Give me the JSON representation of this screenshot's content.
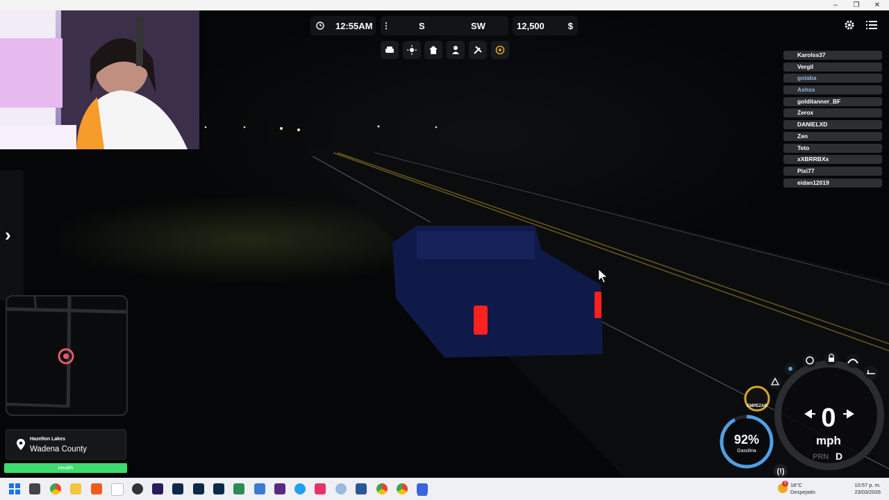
{
  "window": {
    "minimize": "–",
    "maximize": "❐",
    "close": "✕"
  },
  "hud": {
    "time": "12:55AM",
    "compass_heading": "S",
    "compass_next": "SW",
    "money": "12,500",
    "currency": "$"
  },
  "toolbar_icons": [
    "car-icon",
    "sun-icon",
    "home-icon",
    "person-icon",
    "tools-icon",
    "settings-circle-icon"
  ],
  "players": [
    {
      "name": "Karolss37",
      "highlight": false
    },
    {
      "name": "Vergil",
      "highlight": false
    },
    {
      "name": "goiaba",
      "highlight": true
    },
    {
      "name": "Ashxs",
      "highlight": true
    },
    {
      "name": "golditanner_BF",
      "highlight": false
    },
    {
      "name": "Zerox",
      "highlight": false
    },
    {
      "name": "DANIELXD",
      "highlight": false
    },
    {
      "name": "Zen",
      "highlight": false
    },
    {
      "name": "Teto",
      "highlight": false
    },
    {
      "name": "xXBRRBXx",
      "highlight": false
    },
    {
      "name": "Pixi77",
      "highlight": false
    },
    {
      "name": "eidan12019",
      "highlight": false
    }
  ],
  "side_panel": {
    "toggle": "›"
  },
  "location": {
    "area": "Hazelton Lakes",
    "county": "Wadena County"
  },
  "health": {
    "label": "Health",
    "level": 1.0,
    "color": "#3ddc6f"
  },
  "vehicle": {
    "start_label": "EMPEZAR",
    "fuel_percent": "92%",
    "fuel_label": "Gasolina",
    "fuel_level": 0.92,
    "speed": "0",
    "speed_unit": "mph",
    "gear": "D",
    "gear_prefix": "PRN"
  },
  "taskbar": {
    "weather_temp": "18°C",
    "weather_desc": "Despejado",
    "weather_badge": "3",
    "clock_time": "10:57 p. m.",
    "clock_date": "23/03/2026"
  },
  "colors": {
    "accent": "#4ea0e6",
    "ring": "#d9a826",
    "health": "#3ddc6f",
    "minimap_marker": "#e85a6a"
  }
}
